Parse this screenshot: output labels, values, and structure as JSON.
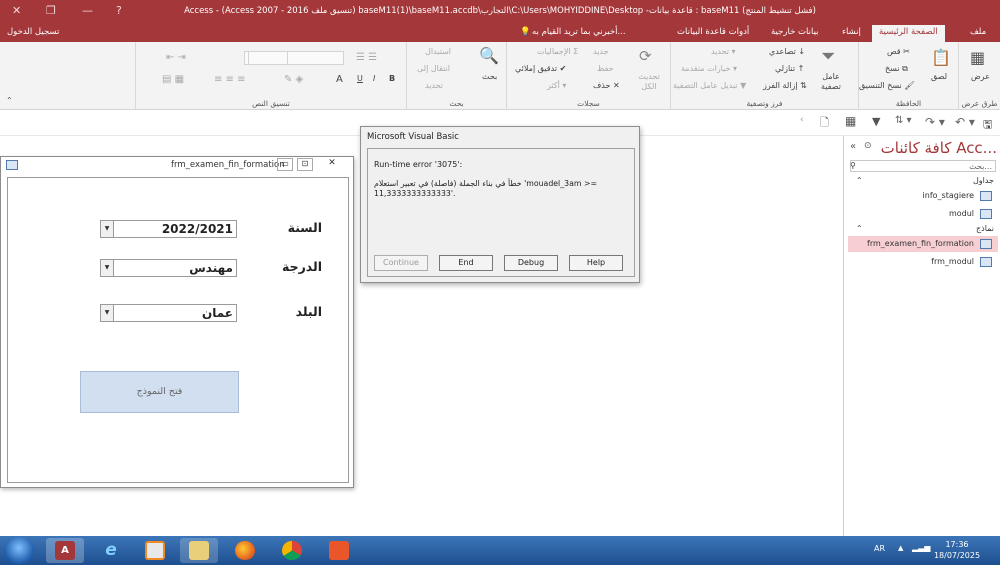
{
  "titlebar": {
    "title": "Access - (Access 2007 - 2016 تنسيق ملف) baseM11(1)\\baseM11.accdb\\التجارب\\C:\\Users\\MOHYIDDINE\\Desktop -قاعدة بيانات : baseM11 (فشل تنشيط المنتج)"
  },
  "tabs": {
    "file": "ملف",
    "home": "الصفحة الرئيسية",
    "create": "إنشاء",
    "external": "بيانات خارجية",
    "dbtools": "أدوات قاعدة البيانات",
    "tellme": "أخبرني بما تريد القيام به...",
    "signin": "تسجيل الدخول"
  },
  "ribbon": {
    "views": {
      "view": "عرض",
      "group": "طرق عرض"
    },
    "clipboard": {
      "paste": "لصق",
      "cut": "قص",
      "copy": "نسخ",
      "format_painter": "نسخ التنسيق",
      "group": "الحافظة"
    },
    "sort_filter": {
      "filter": "عامل تصفية",
      "ascending": "تصاعدي",
      "descending": "تنازلي",
      "remove_sort": "إزالة الفرز",
      "selection": "تحديد",
      "advanced": "خيارات متقدمة",
      "toggle_filter": "تبديل عامل التصفية",
      "group": "فرز وتصفية"
    },
    "records": {
      "refresh": "تحديث الكل",
      "new": "جديد",
      "save": "حفظ",
      "delete": "حذف",
      "totals": "الإجماليات",
      "spelling": "تدقيق إملائي",
      "more": "أكثر",
      "group": "سجلات"
    },
    "find": {
      "find": "بحث",
      "replace": "استبدال",
      "goto": "انتقال إلى",
      "select": "تحديد",
      "group": "بحث"
    },
    "text_format": {
      "bold": "B",
      "italic": "I",
      "underline": "U",
      "font_color": "A",
      "group": "تنسيق النص"
    }
  },
  "nav": {
    "title": "كافة كائنات Acc...",
    "search_placeholder": "بحث...",
    "sections": [
      {
        "label": "جداول",
        "items": [
          "info_stagiere",
          "modul"
        ]
      },
      {
        "label": "نماذج",
        "items": [
          "frm_examen_fin_formation",
          "frm_modul"
        ]
      }
    ]
  },
  "form": {
    "title": "frm_examen_fin_formation",
    "year_label": "السنة",
    "year_value": "2022/2021",
    "grade_label": "الدرجة",
    "grade_value": "مهندس",
    "country_label": "البلد",
    "country_value": "عمان",
    "open_button": "فتح النموذج"
  },
  "dialog": {
    "title": "Microsoft Visual Basic",
    "error": "Run-time error '3075':",
    "message": "خطأ في بناء الجملة (فاصلة) في تعبير استعلام 'mouadel_3am >= 11,3333333333333'.",
    "buttons": {
      "continue": "Continue",
      "end": "End",
      "debug": "Debug",
      "help": "Help"
    }
  },
  "taskbar": {
    "lang": "AR",
    "time": "17:36",
    "date": "18/07/2025"
  },
  "colors": {
    "access_red": "#a4373a",
    "taskbar_blue": "#2b62a5",
    "selected_nav": "#f7cfd3"
  }
}
